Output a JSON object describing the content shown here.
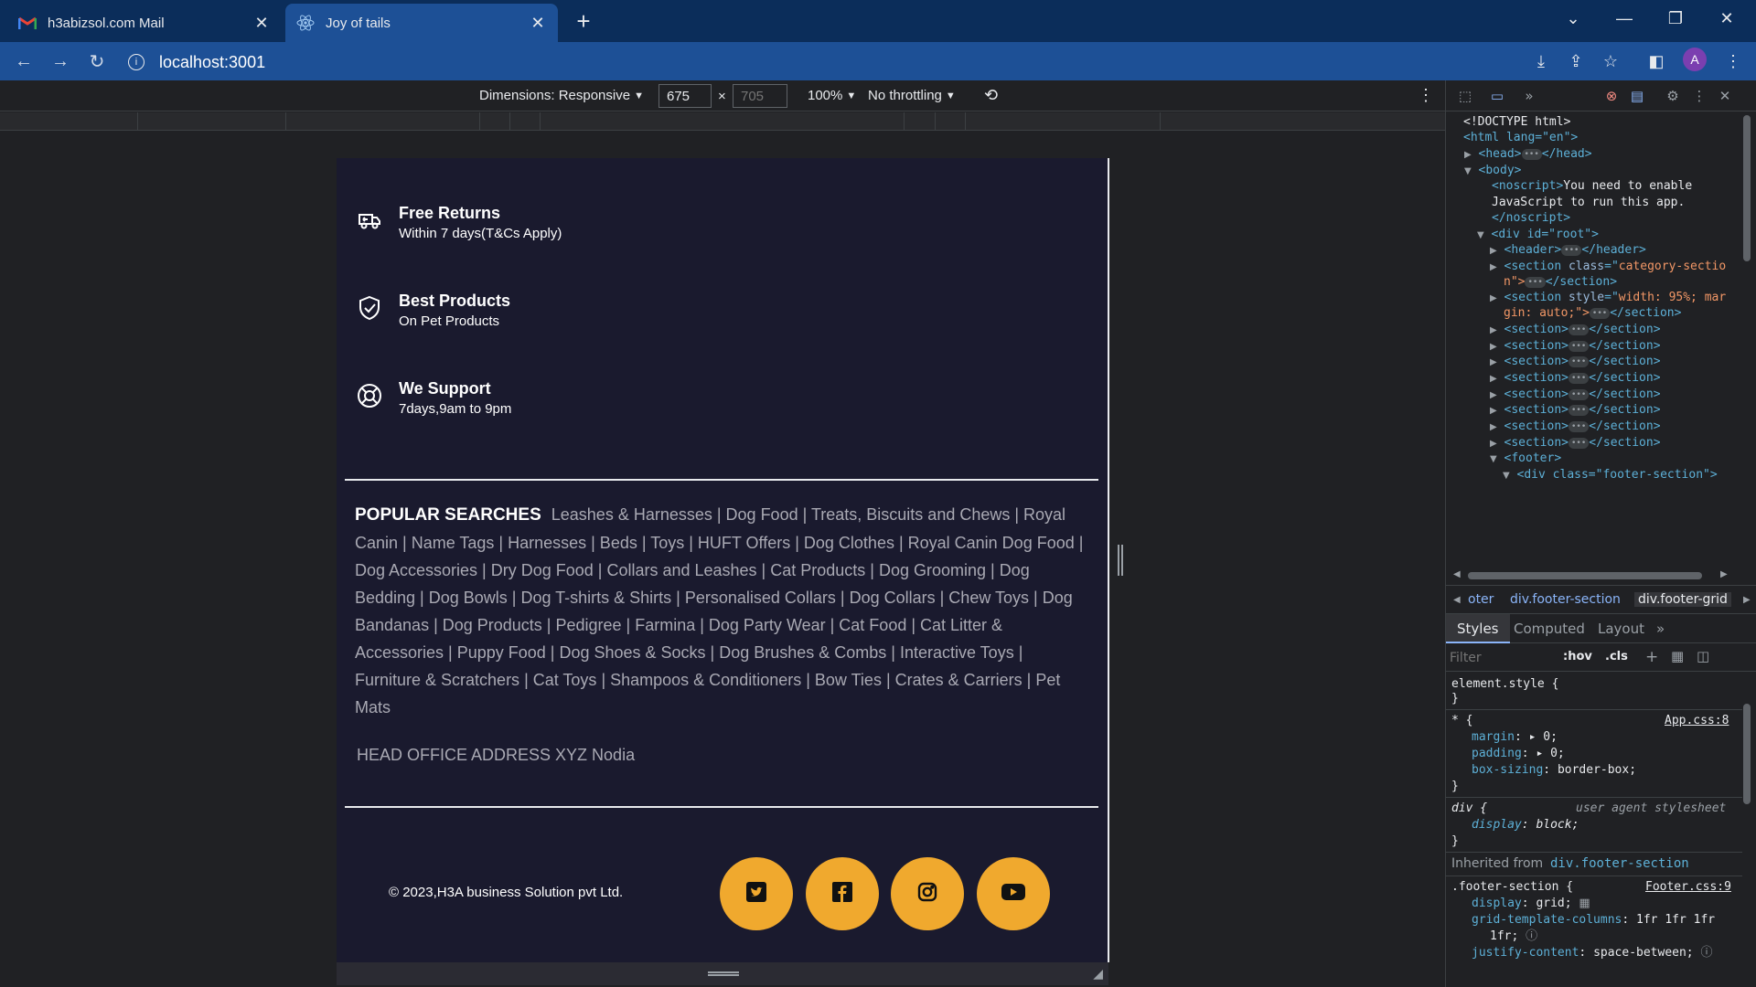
{
  "browser": {
    "tabs": [
      {
        "title": "h3abizsol.com Mail",
        "active": false,
        "icon": "gmail-icon"
      },
      {
        "title": "Joy of tails",
        "active": true,
        "icon": "react-icon"
      }
    ],
    "url": "localhost:3001",
    "profile_initial": "A"
  },
  "device_toolbar": {
    "dimensions_label": "Dimensions: Responsive",
    "width": "675",
    "height_placeholder": "705",
    "zoom": "100%",
    "throttling": "No throttling"
  },
  "page": {
    "features": [
      {
        "title": "Free Returns",
        "subtitle": "Within 7 days(T&Cs Apply)",
        "icon": "truck-return-icon"
      },
      {
        "title": "Best Products",
        "subtitle": "On Pet Products",
        "icon": "shield-check-icon"
      },
      {
        "title": "We Support",
        "subtitle": "7days,9am to 9pm",
        "icon": "lifebuoy-icon"
      }
    ],
    "popular_heading": "POPULAR SEARCHES",
    "popular_searches": "Leashes & Harnesses | Dog Food | Treats, Biscuits and Chews | Royal Canin | Name Tags | Harnesses | Beds | Toys | HUFT Offers | Dog Clothes | Royal Canin Dog Food | Dog Accessories | Dry Dog Food | Collars and Leashes | Cat Products | Dog Grooming | Dog Bedding | Dog Bowls | Dog T-shirts & Shirts | Personalised Collars | Dog Collars | Chew Toys | Dog Bandanas | Dog Products | Pedigree | Farmina | Dog Party Wear | Cat Food | Cat Litter & Accessories | Puppy Food | Dog Shoes & Socks | Dog Brushes & Combs | Interactive Toys | Furniture & Scratchers | Cat Toys | Shampoos & Conditioners | Bow Ties | Crates & Carriers | Pet Mats",
    "office_address": "HEAD OFFICE ADDRESS XYZ Nodia",
    "copyright": "© 2023,H3A business Solution pvt Ltd.",
    "social": [
      "twitter-icon",
      "facebook-icon",
      "instagram-icon",
      "youtube-icon"
    ],
    "accent_color": "#f0a92e",
    "background_color": "#1a1a2e"
  },
  "devtools": {
    "elements": {
      "doctype": "<!DOCTYPE html>",
      "html_open": "<html lang=\"en\">",
      "head": "<head>",
      "head_close": "</head>",
      "body": "<body>",
      "noscript_text_1": "You need to enable",
      "noscript_text_2": "JavaScript to run this app.",
      "root_div": "<div id=\"root\">",
      "section_class_1": "category-sectio",
      "section_class_2": "n\">",
      "section_style_1": "width: 95%; mar",
      "section_style_2": "gin: auto;\">",
      "footer": "<footer>",
      "footer_div": "<div class=\"footer-section\">"
    },
    "breadcrumbs": [
      "oter",
      "div.footer-section",
      "div.footer-grid"
    ],
    "subtabs": [
      "Styles",
      "Computed",
      "Layout"
    ],
    "filter_placeholder": "Filter",
    "filter_buttons": [
      ":hov",
      ".cls"
    ],
    "styles": {
      "element_style": "element.style {",
      "star_selector": "* {",
      "star_source": "App.css:8",
      "margin": "0;",
      "padding": "0;",
      "box_sizing": "border-box;",
      "div_selector": "div {",
      "ua_label": "user agent stylesheet",
      "display_block": "block;",
      "inherited_label": "Inherited from",
      "inherited_from": "div.footer-section",
      "footer_selector": ".footer-section {",
      "footer_source": "Footer.css:9",
      "display_grid": "grid;",
      "grid_cols_1": "1fr 1fr 1fr",
      "grid_cols_2": "1fr;",
      "justify": "space-between;"
    }
  }
}
